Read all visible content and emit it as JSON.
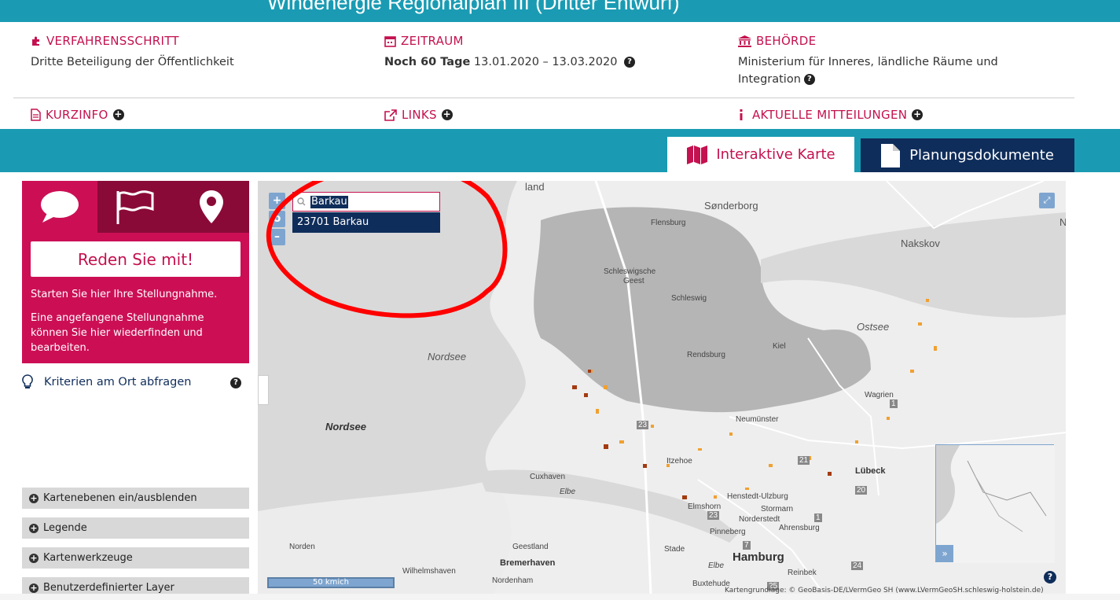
{
  "header": {
    "title": "Windenergie Regionalplan III (Dritter Entwurf)"
  },
  "info": {
    "verfahren": {
      "label": "VERFAHRENSSCHRITT",
      "value": "Dritte Beteiligung der Öffentlichkeit"
    },
    "zeitraum": {
      "label": "ZEITRAUM",
      "days": "Noch 60 Tage",
      "range": "13.01.2020 – 13.03.2020"
    },
    "behoerde": {
      "label": "BEHÖRDE",
      "value_line1": "Ministerium für Inneres, ländliche Räume und",
      "value_line2": "Integration"
    },
    "kurzinfo": "KURZINFO",
    "links": "LINKS",
    "mitteilungen": "AKTUELLE MITTEILUNGEN"
  },
  "tabs": {
    "map": "Interaktive Karte",
    "docs": "Planungsdokumente"
  },
  "sidebar": {
    "button": "Reden Sie mit!",
    "text1": "Starten Sie hier Ihre Stellungnahme.",
    "text2": "Eine angefangene Stellungnahme können Sie hier wiederfinden und bearbeiten.",
    "kriterien": "Kriterien am Ort abfragen",
    "accordions": [
      "Kartenebenen ein/ausblenden",
      "Legende",
      "Kartenwerkzeuge",
      "Benutzerdefinierter Layer"
    ]
  },
  "map": {
    "zoom_in": "+",
    "zoom_reset": "o",
    "zoom_out": "–",
    "search": {
      "value": "Barkau",
      "result": "23701 Barkau"
    },
    "scale": "50 km",
    "scale_suffix": "ich",
    "attribution": "Kartengrundlage: © GeoBasis-DE/LVermGeo SH (www.LVermGeoSH.schleswig-holstein.de)",
    "labels": {
      "land": "land",
      "sonderborg": "Sønderborg",
      "nakskov": "Nakskov",
      "n": "N",
      "flensburg": "Flensburg",
      "geest1": "Schleswigsche",
      "geest2": "Geest",
      "schleswig": "Schleswig",
      "ostsee": "Ostsee",
      "kiel": "Kiel",
      "rendsburg": "Rendsburg",
      "nordsee1": "Nordsee",
      "nordsee2": "Nordsee",
      "wagrien": "Wagrien",
      "neumuenster": "Neumünster",
      "itzehoe": "Itzehoe",
      "cuxhaven": "Cuxhaven",
      "elbe1": "Elbe",
      "luebeck": "Lübeck",
      "henstedt": "Henstedt-Ulzburg",
      "stormarn": "Stormarn",
      "elmshorn": "Elmshorn",
      "norderstedt": "Norderstedt",
      "ahrensburg": "Ahrensburg",
      "pinneberg": "Pinneberg",
      "norden": "Norden",
      "geestland": "Geestland",
      "bremerhaven": "Bremerhaven",
      "stade": "Stade",
      "hamburg": "Hamburg",
      "elbe2": "Elbe",
      "wilhelmshaven": "Wilhelmshaven",
      "nordenham": "Nordenham",
      "buxtehude": "Buxtehude",
      "reinbek": "Reinbek",
      "r23a": "23",
      "r23b": "23",
      "r21": "21",
      "r20": "20",
      "r1a": "1",
      "r1b": "1",
      "r7": "7",
      "r24": "24",
      "r25": "25"
    }
  },
  "colors": {
    "brand": "#cc0f55",
    "teal": "#1a9bb3",
    "navy": "#0f2d5a",
    "annotation": "#ff0000"
  },
  "icons": [
    "puzzle-icon",
    "calendar-icon",
    "bank-icon",
    "document-icon",
    "external-link-icon",
    "info-icon",
    "map-icon",
    "file-icon",
    "chat-icon",
    "flag-icon",
    "pin-icon",
    "lightbulb-icon",
    "search-icon"
  ]
}
